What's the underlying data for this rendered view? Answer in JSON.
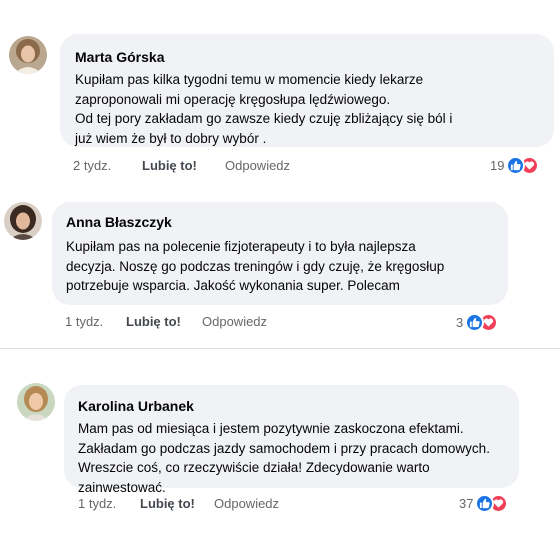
{
  "comments": [
    {
      "author": "Marta Górska",
      "lines": [
        "Kupiłam pas kilka tygodni temu w momencie kiedy lekarze",
        "zaproponowali mi operację kręgosłupa lędźwiowego.",
        "Od tej pory zakładam go zawsze kiedy czuję zbliżający się ból i",
        "już wiem że był to dobry wybór ."
      ],
      "time": "2 tydz.",
      "like_label": "Lubię to!",
      "reply_label": "Odpowiedz",
      "reactions_count": "19"
    },
    {
      "author": "Anna Błaszczyk",
      "lines": [
        "Kupiłam pas na polecenie fizjoterapeuty i to była najlepsza",
        "decyzja. Noszę go podczas treningów i gdy czuję, że kręgosłup",
        "potrzebuje wsparcia. Jakość wykonania super. Polecam"
      ],
      "time": "1 tydz.",
      "like_label": "Lubię to!",
      "reply_label": "Odpowiedz",
      "reactions_count": "3"
    },
    {
      "author": "Karolina Urbanek",
      "lines": [
        "Mam pas od miesiąca i jestem pozytywnie zaskoczona efektami.",
        "Zakładam go podczas jazdy samochodem i przy pracach domowych.",
        "Wreszcie coś, co rzeczywiście działa! Zdecydowanie warto",
        "zainwestować."
      ],
      "time": "1 tydz.",
      "like_label": "Lubię to!",
      "reply_label": "Odpowiedz",
      "reactions_count": "37"
    }
  ],
  "reaction_icons": [
    "thumbs-up-icon",
    "heart-icon"
  ],
  "colors": {
    "bubble": "#f0f2f5",
    "like_reaction": "#1b74e4",
    "love_reaction": "#f33e58",
    "meta_text": "#65676b"
  }
}
